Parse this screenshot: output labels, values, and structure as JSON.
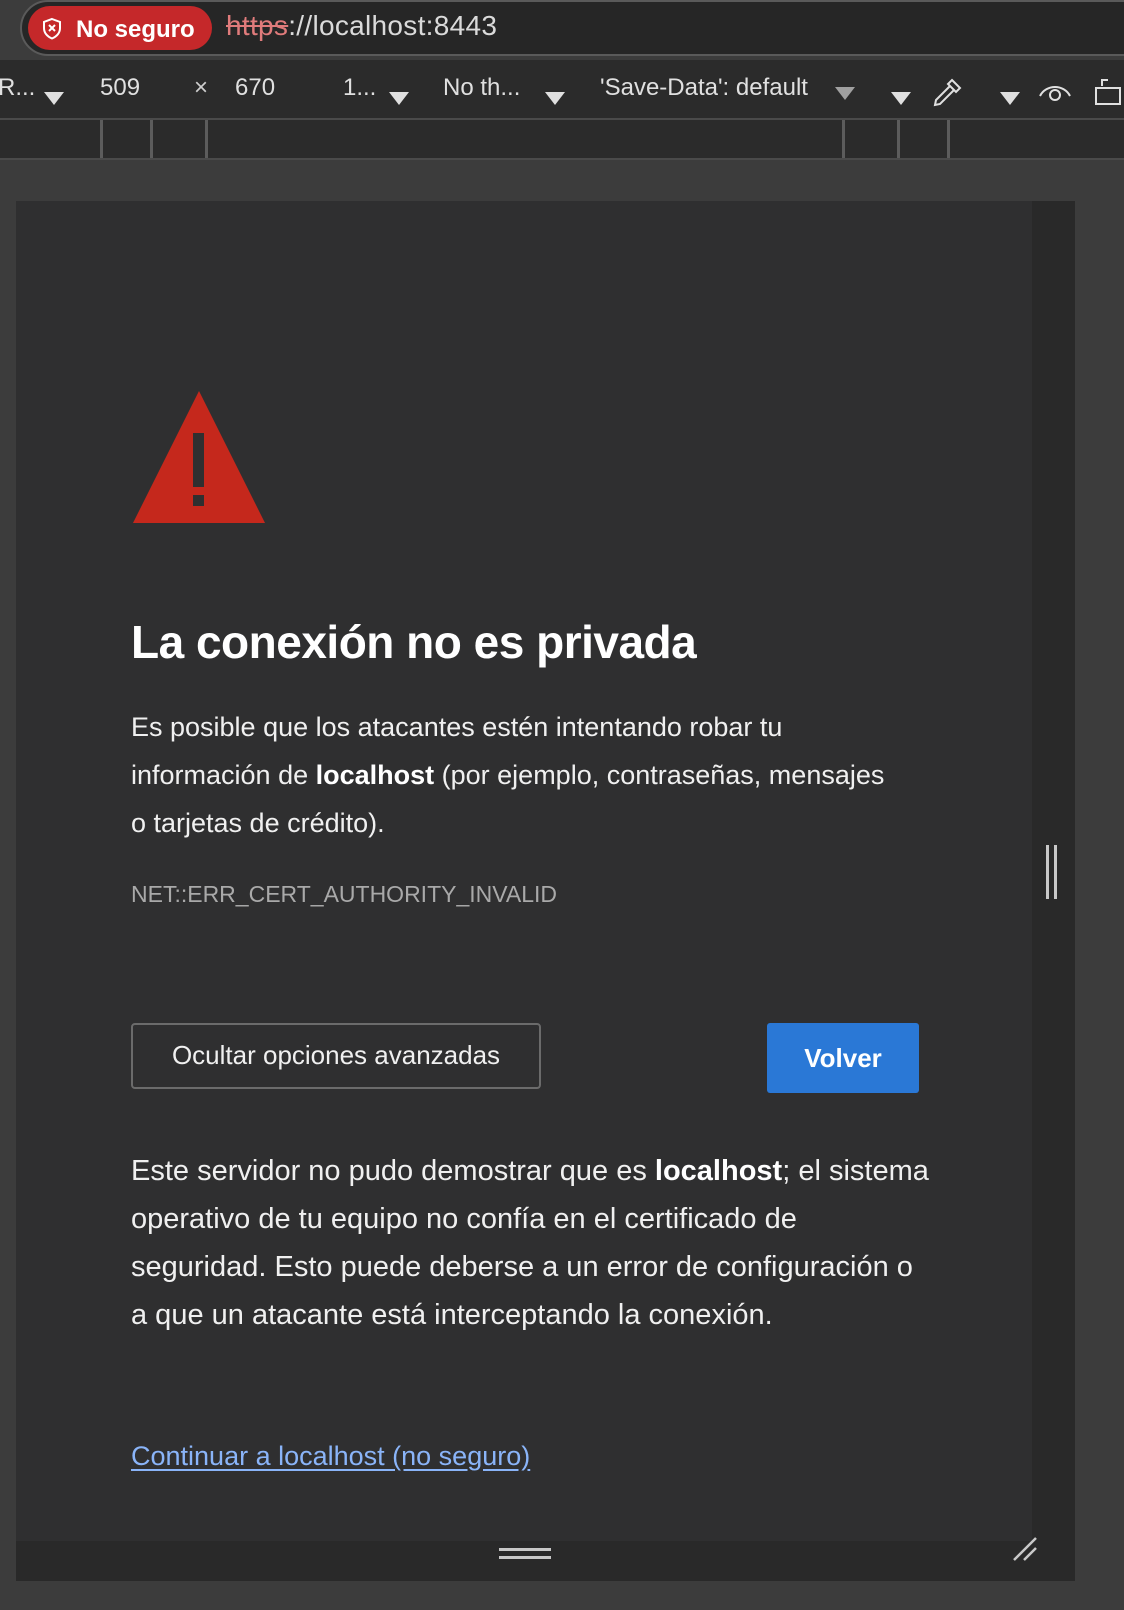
{
  "address_bar": {
    "security_chip_label": "No seguro",
    "url_scheme": "https",
    "url_rest": "://localhost:8443"
  },
  "device_toolbar": {
    "device_label": "R...",
    "width": "509",
    "times": "×",
    "height": "670",
    "zoom": "1...",
    "throttling": "No th...",
    "save_data": "'Save-Data': default"
  },
  "interstitial": {
    "title": "La conexión no es privada",
    "lead_part1": "Es posible que los atacantes estén intentando robar tu información de ",
    "lead_host": "localhost",
    "lead_part2": " (por ejemplo, contraseñas, mensajes o tarjetas de crédito).",
    "error_code": "NET::ERR_CERT_AUTHORITY_INVALID",
    "advanced_button": "Ocultar opciones avanzadas",
    "back_button": "Volver",
    "details_part1": "Este servidor no pudo demostrar que es ",
    "details_host": "localhost",
    "details_part2": "; el sistema operativo de tu equipo no confía en el certificado de seguridad. Esto puede deberse a un error de configuración o a que un atacante está interceptando la conexión.",
    "proceed_link": "Continuar a localhost (no seguro)"
  },
  "colors": {
    "danger_red": "#c5282a",
    "warning_red": "#c5281c",
    "primary_blue": "#2a78d6",
    "link_blue": "#8ab4f8",
    "page_bg": "#2f2f30"
  }
}
